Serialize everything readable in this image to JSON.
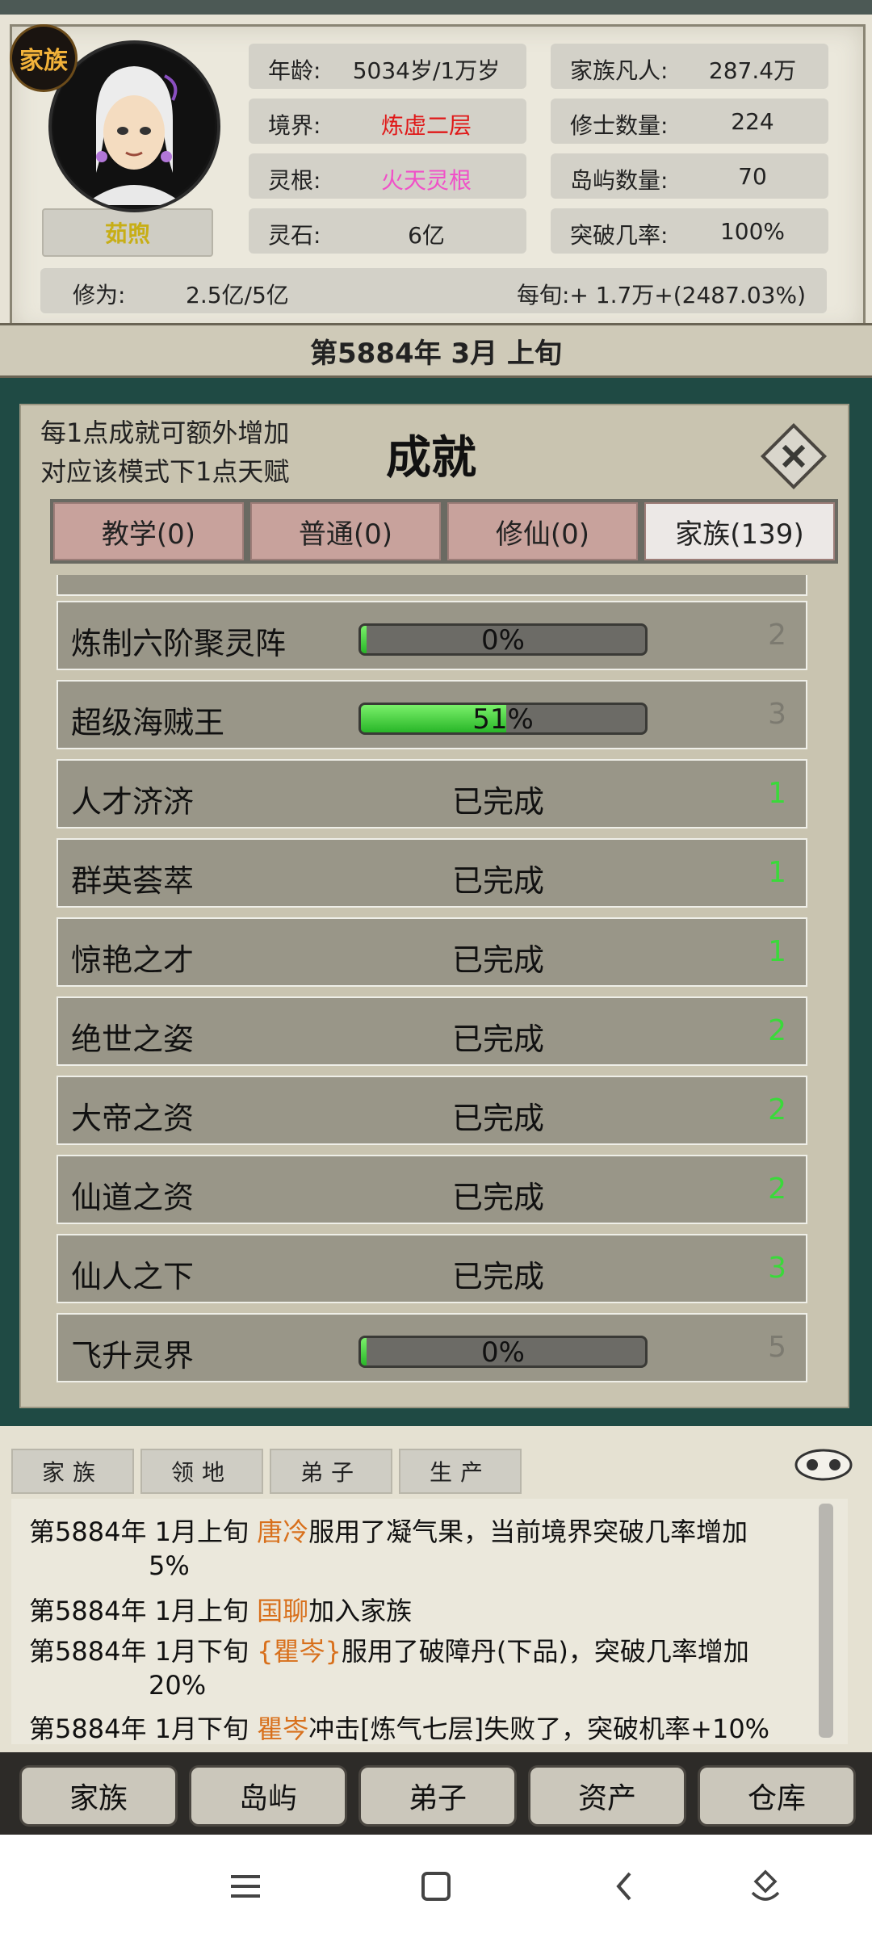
{
  "header": {
    "clan_badge": "家族",
    "player_name": "茹煦",
    "stats_left": [
      {
        "label": "年龄:",
        "value": "5034岁/1万岁",
        "color": "#222222"
      },
      {
        "label": "境界:",
        "value": "炼虚二层",
        "color": "#e01818"
      },
      {
        "label": "灵根:",
        "value": "火天灵根",
        "color": "#f050c8"
      },
      {
        "label": "灵石:",
        "value": "6亿",
        "color": "#222222"
      }
    ],
    "stats_right": [
      {
        "label": "家族凡人:",
        "value": "287.4万"
      },
      {
        "label": "修士数量:",
        "value": "224"
      },
      {
        "label": "岛屿数量:",
        "value": "70"
      },
      {
        "label": "突破几率:",
        "value": "100%"
      }
    ],
    "cultivation_label": "修为:",
    "cultivation_value": "2.5亿/5亿",
    "per_period": "每旬:+ 1.7万+(2487.03%)",
    "date": "第5884年 3月 上旬"
  },
  "modal": {
    "desc_line1": "每1点成就可额外增加",
    "desc_line2": "对应该模式下1点天赋",
    "title": "成就",
    "tabs": [
      "教学(0)",
      "普通(0)",
      "修仙(0)",
      "家族(139)"
    ],
    "active_tab": 3,
    "rows": [
      {
        "name": "炼制六阶聚灵阵",
        "status": "",
        "progress": 0,
        "progress_text": "0%",
        "points": "2",
        "done": false
      },
      {
        "name": "超级海贼王",
        "status": "",
        "progress": 51,
        "progress_text": "51%",
        "points": "3",
        "done": false
      },
      {
        "name": "人才济济",
        "status": "已完成",
        "points": "1",
        "done": true
      },
      {
        "name": "群英荟萃",
        "status": "已完成",
        "points": "1",
        "done": true
      },
      {
        "name": "惊艳之才",
        "status": "已完成",
        "points": "1",
        "done": true
      },
      {
        "name": "绝世之姿",
        "status": "已完成",
        "points": "2",
        "done": true
      },
      {
        "name": "大帝之资",
        "status": "已完成",
        "points": "2",
        "done": true
      },
      {
        "name": "仙道之资",
        "status": "已完成",
        "points": "2",
        "done": true
      },
      {
        "name": "仙人之下",
        "status": "已完成",
        "points": "3",
        "done": true
      },
      {
        "name": "飞升灵界",
        "status": "",
        "progress": 0,
        "progress_text": "0%",
        "points": "5",
        "done": false
      }
    ]
  },
  "log": {
    "tabs": [
      "家族",
      "领地",
      "弟子",
      "生产"
    ],
    "entries": [
      {
        "date": "第5884年 1月上旬 ",
        "who": "唐冷",
        "text": "服用了凝气果，当前境界突破几率增加",
        "cont": "5%"
      },
      {
        "date": "第5884年 1月上旬 ",
        "who": "国聊",
        "text": "加入家族",
        "cont": ""
      },
      {
        "date": "第5884年 1月下旬 ",
        "who": "{瞿岑}",
        "text": "服用了破障丹(下品)，突破几率增加",
        "cont": "20%"
      },
      {
        "date": "第5884年 1月下旬 ",
        "who": "瞿岑",
        "text": "冲击[炼气七层]失败了，突破机率+10%",
        "cont": ""
      }
    ]
  },
  "nav": [
    "家族",
    "岛屿",
    "弟子",
    "资产",
    "仓库"
  ],
  "system_icons": [
    "menu-icon",
    "home-icon",
    "back-icon",
    "assistant-icon"
  ]
}
